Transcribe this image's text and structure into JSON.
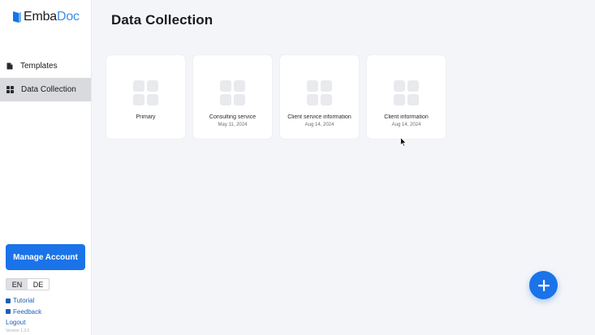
{
  "app": {
    "logo_part1": "Emba",
    "logo_part2": "Doc"
  },
  "sidebar": {
    "items": [
      {
        "label": "Templates",
        "icon": "file-icon",
        "active": false
      },
      {
        "label": "Data Collection",
        "icon": "grid-icon",
        "active": true
      }
    ],
    "manage_account_label": "Manage Account",
    "languages": [
      "EN",
      "DE"
    ],
    "selected_language": "EN",
    "links": [
      {
        "label": "Tutorial",
        "icon": "tutorial-icon"
      },
      {
        "label": "Feedback",
        "icon": "feedback-icon"
      }
    ],
    "logout_label": "Logout",
    "version": "Version 1.3.0"
  },
  "main": {
    "title": "Data Collection",
    "cards": [
      {
        "name": "Primary",
        "date": ""
      },
      {
        "name": "Consulting service",
        "date": "May 11, 2024"
      },
      {
        "name": "Client service information",
        "date": "Aug 14, 2024"
      },
      {
        "name": "Client information",
        "date": "Aug 14, 2024"
      }
    ]
  },
  "colors": {
    "accent": "#1a73e8",
    "logo_accent": "#3b8ee8",
    "active_nav": "#d9dadd",
    "background": "#f4f5f8"
  }
}
